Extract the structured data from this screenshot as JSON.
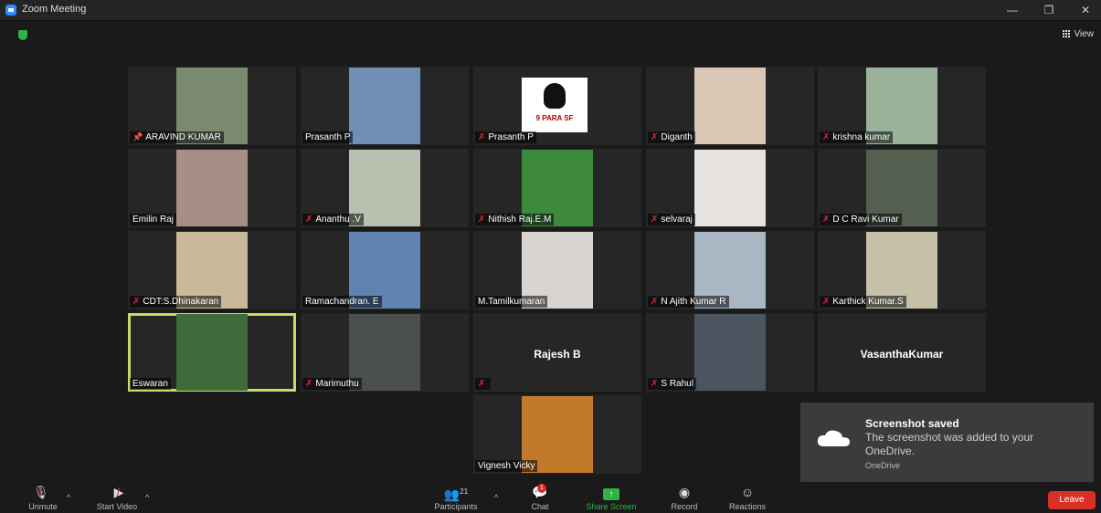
{
  "window": {
    "title": "Zoom Meeting",
    "controls": [
      "—",
      "❐",
      "✕"
    ]
  },
  "view_label": "View",
  "participants": [
    {
      "name": "ARAVIND KUMAR",
      "pinned": true,
      "muted": false,
      "bg": "#7a8a6e"
    },
    {
      "name": "Prasanth P",
      "muted": false,
      "bg": "#6f8fb5"
    },
    {
      "name": "Prasanth P",
      "muted": true,
      "bg": "#ffffff"
    },
    {
      "name": "Diganth",
      "muted": true,
      "bg": "#d9c6b4"
    },
    {
      "name": "krishna kumar",
      "muted": true,
      "bg": "#9ab39a"
    },
    {
      "name": "Emilin Raj",
      "muted": false,
      "bg": "#a88f86"
    },
    {
      "name": "Ananthu .V",
      "muted": true,
      "bg": "#b9c0b0"
    },
    {
      "name": "Nithish Raj.E.M",
      "muted": true,
      "bg": "#3d8a3d"
    },
    {
      "name": "selvaraj",
      "muted": true,
      "bg": "#e5e2df"
    },
    {
      "name": "D C Ravi Kumar",
      "muted": true,
      "bg": "#555f4f"
    },
    {
      "name": "CDT:S.Dhinakaran",
      "muted": true,
      "bg": "#c9b89a"
    },
    {
      "name": "Ramachandran. E",
      "muted": false,
      "bg": "#5f83b3"
    },
    {
      "name": "M.Tamilkumaran",
      "muted": false,
      "bg": "#d8d4cf"
    },
    {
      "name": "N Ajith Kumar R",
      "muted": true,
      "bg": "#a9b6c4"
    },
    {
      "name": "Karthick Kumar.S",
      "muted": true,
      "bg": "#c6c0a8"
    },
    {
      "name": "Eswaran",
      "muted": false,
      "bg": "#3f6a3a",
      "active": true
    },
    {
      "name": "Marimuthu",
      "muted": true,
      "bg": "#4a4f4c"
    },
    {
      "name": "",
      "muted": true,
      "center_name": "Rajesh B"
    },
    {
      "name": "S Rahul",
      "muted": true,
      "bg": "#4a5560"
    },
    {
      "name": "",
      "muted": false,
      "center_name": "VasanthaKumar"
    },
    {
      "name": "Vignesh Vicky",
      "muted": false,
      "bg": "#c27a2a"
    }
  ],
  "logo_text": "9 PARA SF",
  "toast": {
    "title": "Screenshot saved",
    "message": "The screenshot was added to your OneDrive.",
    "source": "OneDrive"
  },
  "toolbar": {
    "unmute": "Unmute",
    "start_video": "Start Video",
    "participants": "Participants",
    "participant_count": "21",
    "chat": "Chat",
    "chat_badge": "1",
    "share_screen": "Share Screen",
    "record": "Record",
    "reactions": "Reactions",
    "leave": "Leave"
  },
  "colors": {
    "share": "#2fb344",
    "leave": "#d93025",
    "active_border": "#c8d96a",
    "muted": "#e0262c"
  }
}
